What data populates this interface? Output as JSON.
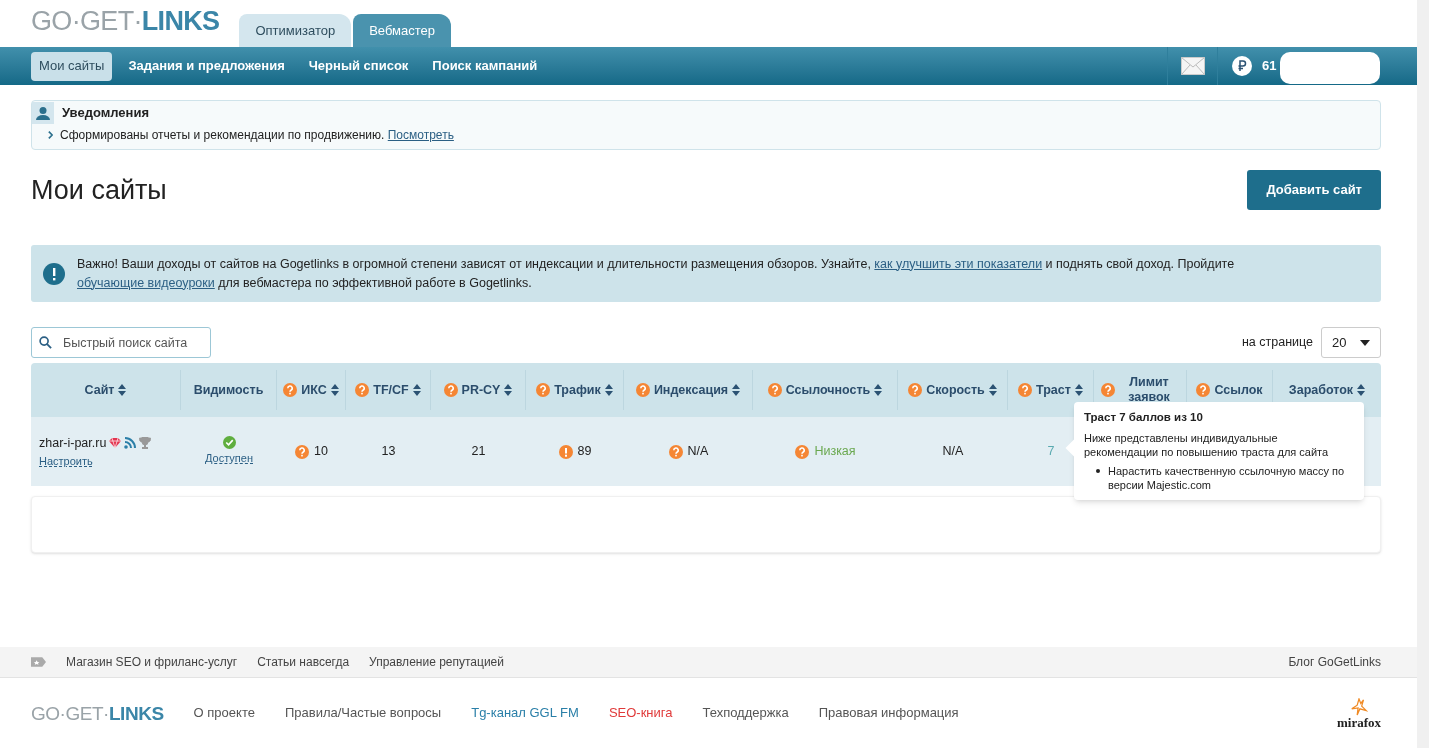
{
  "logo": [
    {
      "text": "GO·GET·",
      "kind": "muted"
    },
    {
      "text": "LINKS",
      "kind": "accent"
    }
  ],
  "role_tabs": [
    {
      "label": "Оптимизатор",
      "selected": false
    },
    {
      "label": "Вебмастер",
      "selected": true
    }
  ],
  "nav": [
    {
      "label": "Мои сайты",
      "selected": true
    },
    {
      "label": "Задания и предложения",
      "selected": false
    },
    {
      "label": "Черный список",
      "selected": false
    },
    {
      "label": "Поиск кампаний",
      "selected": false
    }
  ],
  "balance": "61",
  "notifications": {
    "title": "Уведомления",
    "text": "Сформированы отчеты и рекомендации по продвижению.",
    "link": "Посмотреть"
  },
  "page_title": "Мои сайты",
  "add_button": "Добавить сайт",
  "alert": {
    "parts": [
      {
        "text": "Важно! Ваши доходы от сайтов на Gogetlinks в огромной степени зависят от индексации и длительности размещения обзоров. Узнайте,",
        "kind": "text"
      },
      {
        "text": "как улучшить эти показатели",
        "kind": "link"
      },
      {
        "text": "и поднять свой доход. Пройдите",
        "kind": "text"
      },
      {
        "text": "обучающие видеоуроки",
        "kind": "link"
      },
      {
        "text": "для вебмастера по эффективной работе в Gogetlinks.",
        "kind": "text"
      }
    ]
  },
  "search": {
    "placeholder": "Быстрый поиск сайта"
  },
  "per_page": {
    "label": "на странице",
    "value": "20"
  },
  "table": {
    "columns": [
      {
        "label": "Сайт",
        "help": false,
        "sortable": true
      },
      {
        "label": "Видимость",
        "help": false,
        "sortable": false
      },
      {
        "label": "ИКС",
        "help": true,
        "sortable": true
      },
      {
        "label": "TF/CF",
        "help": true,
        "sortable": true
      },
      {
        "label": "PR-CY",
        "help": true,
        "sortable": true
      },
      {
        "label": "Трафик",
        "help": true,
        "sortable": true
      },
      {
        "label": "Индексация",
        "help": true,
        "sortable": true
      },
      {
        "label": "Ссылочность",
        "help": true,
        "sortable": true
      },
      {
        "label": "Скорость",
        "help": true,
        "sortable": true
      },
      {
        "label": "Траст",
        "help": true,
        "sortable": true
      },
      {
        "label": "Лимит заявок",
        "help": true,
        "sortable": false
      },
      {
        "label": "Ссылок",
        "help": true,
        "sortable": false
      },
      {
        "label": "Заработок",
        "help": false,
        "sortable": true
      }
    ],
    "rows": [
      {
        "cells": [
          {
            "kind": "site",
            "text": "zhar-i-par.ru",
            "link": "Настроить"
          },
          {
            "kind": "status",
            "text": "Доступен"
          },
          {
            "kind": "help",
            "text": "10"
          },
          {
            "kind": "plain",
            "text": "13"
          },
          {
            "kind": "plain",
            "text": "21"
          },
          {
            "kind": "warning",
            "text": "89"
          },
          {
            "kind": "help",
            "text": "N/A"
          },
          {
            "kind": "help_good",
            "text": "Низкая"
          },
          {
            "kind": "plain",
            "text": "N/A"
          },
          {
            "kind": "score",
            "text": "7"
          }
        ]
      }
    ]
  },
  "tooltip": {
    "title": "Траст 7 баллов из 10",
    "text": "Ниже представлены индивидуальные рекомендации по повышению траста для сайта",
    "bullets": [
      "Нарастить качественную ссылочную массу по версии Majestic.com"
    ]
  },
  "footer_links": [
    "Магазин SEO и фриланс-услуг",
    "Статьи навсегда",
    "Управление репутацией"
  ],
  "footer_blog": "Блог GoGetLinks",
  "footer_logo": [
    {
      "text": "GO·GET·",
      "kind": "muted"
    },
    {
      "text": "LINKS",
      "kind": "accent"
    }
  ],
  "footer_nav": [
    {
      "label": "О проекте",
      "color": "#555555"
    },
    {
      "label": "Правила/Частые вопросы",
      "color": "#555555"
    },
    {
      "label": "Tg-канал GGL FM",
      "color": "#2a7fa8"
    },
    {
      "label": "SEO-книга",
      "color": "#e03a3a"
    },
    {
      "label": "Техподдержка",
      "color": "#555555"
    },
    {
      "label": "Правовая информация",
      "color": "#555555"
    }
  ],
  "footer_brand": "mirafox"
}
